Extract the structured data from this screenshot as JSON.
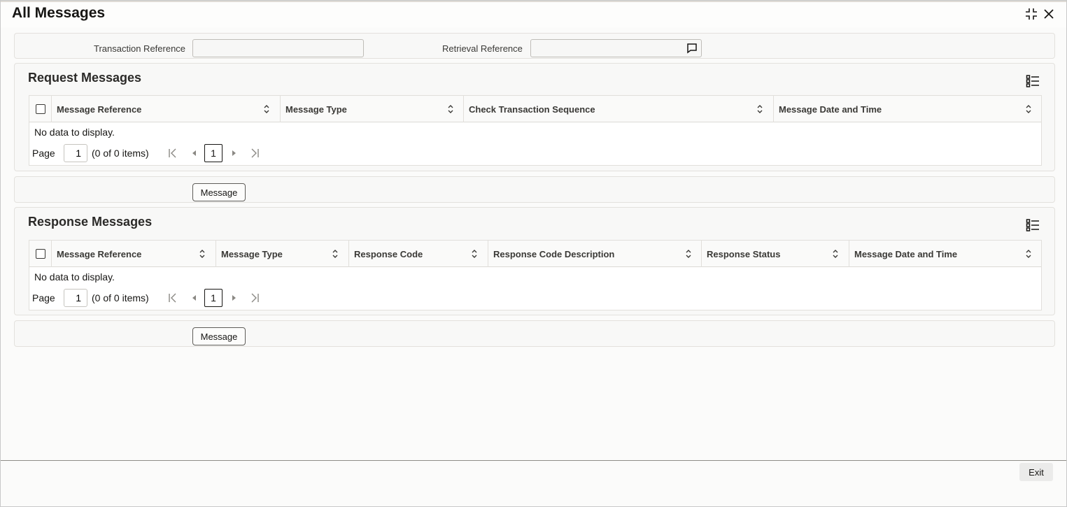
{
  "window": {
    "title": "All Messages",
    "restore_icon": "restore-icon",
    "close_icon": "close-icon"
  },
  "filters": {
    "transaction_reference_label": "Transaction Reference",
    "transaction_reference_value": "",
    "retrieval_reference_label": "Retrieval Reference",
    "retrieval_reference_value": "",
    "retrieval_icon": "message-icon"
  },
  "request": {
    "title": "Request Messages",
    "columns": [
      "Message Reference",
      "Message Type",
      "Check Transaction Sequence",
      "Message Date and Time"
    ],
    "no_data": "No data to display.",
    "page_label": "Page",
    "page_value": "1",
    "page_count": "(0 of 0 items)",
    "current_page": "1",
    "message_button": "Message"
  },
  "response": {
    "title": "Response Messages",
    "columns": [
      "Message Reference",
      "Message Type",
      "Response Code",
      "Response Code Description",
      "Response Status",
      "Message Date and Time"
    ],
    "no_data": "No data to display.",
    "page_label": "Page",
    "page_value": "1",
    "page_count": "(0 of 0 items)",
    "current_page": "1",
    "message_button": "Message"
  },
  "footer": {
    "exit_label": "Exit"
  }
}
